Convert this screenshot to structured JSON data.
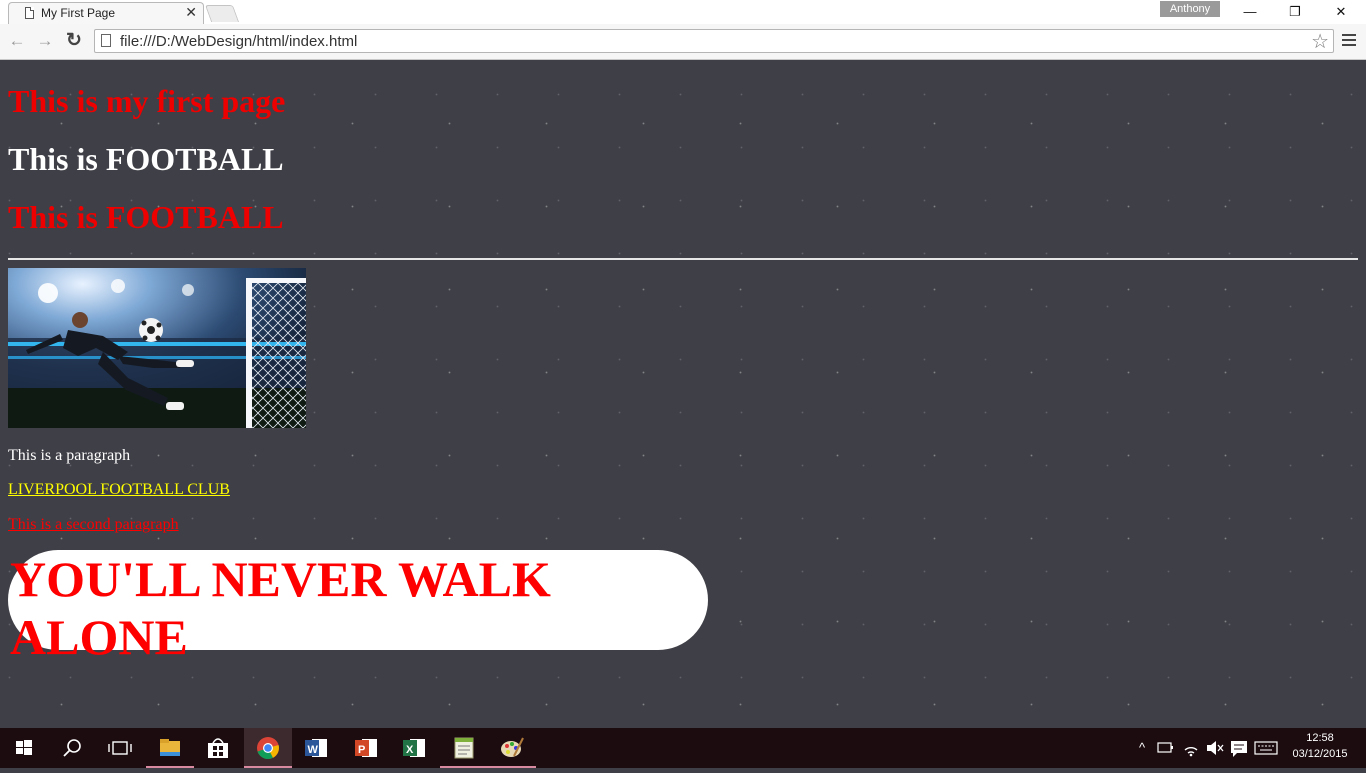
{
  "browser": {
    "tab_title": "My First Page",
    "tab_close": "✕",
    "profile_name": "Anthony",
    "url": "file:///D:/WebDesign/html/index.html",
    "window_controls": {
      "minimize": "—",
      "restore": "❐",
      "close": "✕"
    },
    "nav": {
      "back": "←",
      "forward": "→",
      "reload": "↻"
    },
    "star": "☆"
  },
  "page": {
    "heading1": "This is my first page",
    "heading2": "This is FOOTBALL",
    "heading3": "This is FOOTBALL",
    "paragraph1": "This is a paragraph",
    "link_text": "LIVERPOOL FOOTBALL CLUB",
    "paragraph2": "This is a second paragraph",
    "banner_text": "YOU'LL NEVER WALK ALONE",
    "colors": {
      "background": "#3f3f47",
      "heading_red": "#ee0000",
      "link_yellow": "#ffff00"
    },
    "image_alt": "Footballer volleying a ball in a floodlit stadium"
  },
  "taskbar": {
    "apps": [
      "start-icon",
      "search-icon",
      "task-view-icon",
      "file-explorer-icon",
      "store-icon",
      "chrome-icon",
      "word-icon",
      "powerpoint-icon",
      "excel-icon",
      "publisher-icon",
      "paint-icon"
    ],
    "tray_chevron": "^",
    "time": "12:58",
    "date": "03/12/2015"
  }
}
